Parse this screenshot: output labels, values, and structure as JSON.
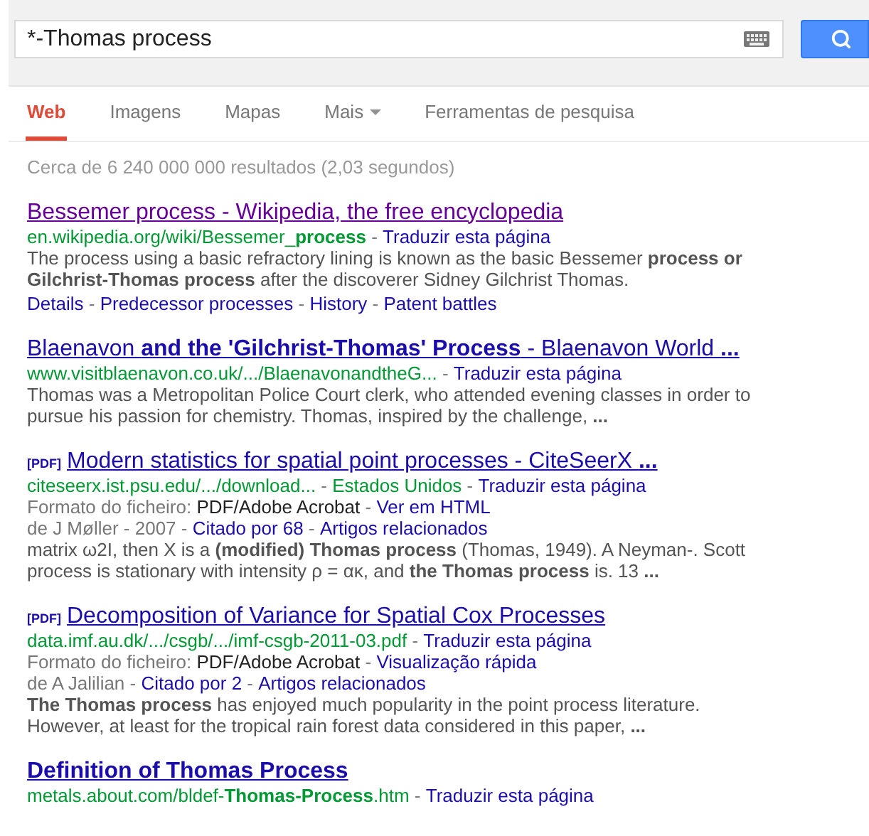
{
  "search": {
    "value": "*-Thomas process"
  },
  "tabs": [
    {
      "label": "Web",
      "selected": true,
      "has_menu": false
    },
    {
      "label": "Imagens",
      "selected": false,
      "has_menu": false
    },
    {
      "label": "Mapas",
      "selected": false,
      "has_menu": false
    },
    {
      "label": "Mais",
      "selected": false,
      "has_menu": true
    },
    {
      "label": "Ferramentas de pesquisa",
      "selected": false,
      "has_menu": false
    }
  ],
  "result_stats": "Cerca de 6 240 000 000 resultados (2,03 segundos)",
  "results": [
    {
      "title": "Bessemer process - Wikipedia, the free encyclopedia",
      "visited": true,
      "bold": false,
      "lines": [
        [
          {
            "kind": "url",
            "text": "en.wikipedia.org/wiki/Bessemer_**process**"
          },
          {
            "kind": "sep",
            "text": " - "
          },
          {
            "kind": "link",
            "text": "Traduzir esta página"
          }
        ]
      ],
      "snippet": "The process using a basic refractory lining is known as the basic Bessemer **process or Gilchrist-Thomas process** after the discoverer Sidney Gilchrist Thomas.",
      "sitelinks": [
        {
          "kind": "link",
          "text": "Details"
        },
        {
          "kind": "sep",
          "text": " - "
        },
        {
          "kind": "link",
          "text": "Predecessor processes"
        },
        {
          "kind": "sep",
          "text": " - "
        },
        {
          "kind": "link",
          "text": "History"
        },
        {
          "kind": "sep",
          "text": " - "
        },
        {
          "kind": "link",
          "text": "Patent battles"
        }
      ]
    },
    {
      "title": "Blaenavon **and the 'Gilchrist-Thomas' Process** - Blaenavon World **...**",
      "visited": false,
      "bold": false,
      "lines": [
        [
          {
            "kind": "url",
            "text": "www.visitblaenavon.co.uk/.../BlaenavonandtheG..."
          },
          {
            "kind": "sep",
            "text": " - "
          },
          {
            "kind": "link",
            "text": "Traduzir esta página"
          }
        ]
      ],
      "snippet": "Thomas was a Metropolitan Police Court clerk, who attended evening classes in order to pursue his passion for chemistry. Thomas, inspired by the challenge, **...**"
    },
    {
      "pdf_tag": "[PDF]",
      "title": "Modern statistics for spatial point processes - CiteSeerX **...**",
      "visited": false,
      "bold": false,
      "lines": [
        [
          {
            "kind": "url",
            "text": "citeseerx.ist.psu.edu/.../download..."
          },
          {
            "kind": "sep",
            "text": " - "
          },
          {
            "kind": "url",
            "text": "Estados Unidos"
          },
          {
            "kind": "sep",
            "text": " - "
          },
          {
            "kind": "link",
            "text": "Traduzir esta página"
          }
        ],
        [
          {
            "kind": "meta",
            "text": "Formato do ficheiro: "
          },
          {
            "kind": "dark",
            "text": "PDF/Adobe Acrobat"
          },
          {
            "kind": "sep",
            "text": " - "
          },
          {
            "kind": "link",
            "text": "Ver em HTML"
          }
        ],
        [
          {
            "kind": "meta",
            "text": "de J Møller"
          },
          {
            "kind": "sep",
            "text": " - "
          },
          {
            "kind": "meta",
            "text": "2007"
          },
          {
            "kind": "sep",
            "text": " - "
          },
          {
            "kind": "link",
            "text": "Citado por 68"
          },
          {
            "kind": "sep",
            "text": " - "
          },
          {
            "kind": "link",
            "text": "Artigos relacionados"
          }
        ]
      ],
      "snippet": "matrix ω2I, then X is a **(modified) Thomas process** (Thomas, 1949). A Neyman-. Scott process is stationary with intensity ρ = ακ, and **the Thomas process** is. 13 **...**"
    },
    {
      "pdf_tag": "[PDF]",
      "title": "Decomposition of Variance for Spatial Cox Processes",
      "visited": false,
      "bold": false,
      "lines": [
        [
          {
            "kind": "url",
            "text": "data.imf.au.dk/.../csgb/.../imf-csgb-2011-03.pdf"
          },
          {
            "kind": "sep",
            "text": " - "
          },
          {
            "kind": "link",
            "text": "Traduzir esta página"
          }
        ],
        [
          {
            "kind": "meta",
            "text": "Formato do ficheiro: "
          },
          {
            "kind": "dark",
            "text": "PDF/Adobe Acrobat"
          },
          {
            "kind": "sep",
            "text": " - "
          },
          {
            "kind": "link",
            "text": "Visualização rápida"
          }
        ],
        [
          {
            "kind": "meta",
            "text": "de A Jalilian"
          },
          {
            "kind": "sep",
            "text": " - "
          },
          {
            "kind": "link",
            "text": "Citado por 2"
          },
          {
            "kind": "sep",
            "text": " - "
          },
          {
            "kind": "link",
            "text": "Artigos relacionados"
          }
        ]
      ],
      "snippet": "**The Thomas process** has enjoyed much popularity in the point process literature. However, at least for the tropical rain forest data considered in this paper, **...**"
    },
    {
      "title": "Definition of Thomas Process",
      "visited": false,
      "bold": true,
      "lines": [
        [
          {
            "kind": "url",
            "text": "metals.about.com/bldef-**Thomas-Process**.htm"
          },
          {
            "kind": "sep",
            "text": " - "
          },
          {
            "kind": "link",
            "text": "Traduzir esta página"
          }
        ]
      ]
    }
  ]
}
